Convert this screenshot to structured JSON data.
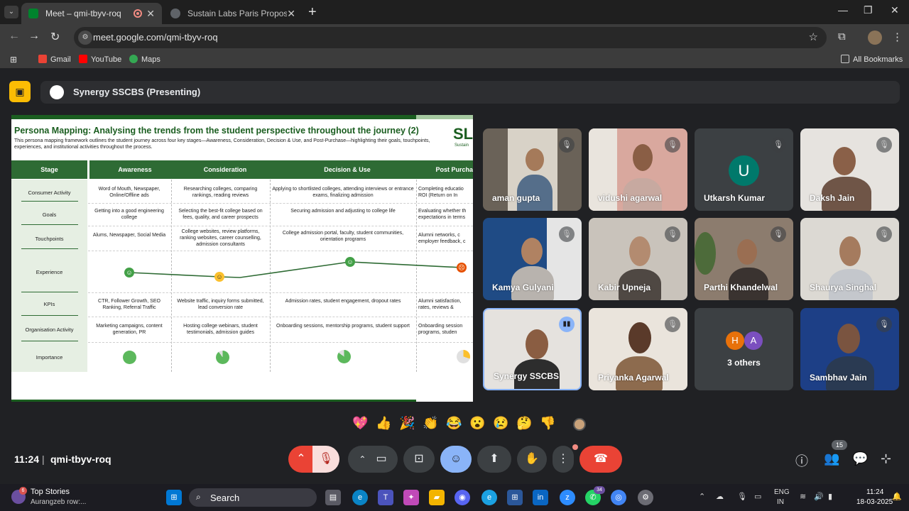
{
  "browser": {
    "tabs": [
      {
        "title": "Meet – qmi-tbyv-roq",
        "active": true
      },
      {
        "title": "Sustain Labs Paris Proposal - Sy",
        "active": false
      }
    ],
    "url": "meet.google.com/qmi-tbyv-roq",
    "bookmarks": [
      "Gmail",
      "YouTube",
      "Maps"
    ],
    "all_bookmarks": "All Bookmarks"
  },
  "meet": {
    "presenting_title": "Synergy SSCBS (Presenting)",
    "time": "11:24",
    "separator": "|",
    "meeting_code": "qmi-tbyv-roq",
    "people_count": "15",
    "reactions": [
      "💖",
      "👍",
      "🎉",
      "👏",
      "😂",
      "😮",
      "😢",
      "🤔",
      "👎"
    ],
    "participants": [
      {
        "name": "aman gupta",
        "muted": true
      },
      {
        "name": "vidushi agarwal",
        "muted": true
      },
      {
        "name": "Utkarsh Kumar",
        "muted": true,
        "initial": "U"
      },
      {
        "name": "Daksh Jain",
        "muted": true
      },
      {
        "name": "Kamya Gulyani",
        "muted": true
      },
      {
        "name": "Kabir Upneja",
        "muted": true
      },
      {
        "name": "Parthi Khandelwal",
        "muted": true
      },
      {
        "name": "Shaurya Singhal",
        "muted": true
      },
      {
        "name": "Synergy SSCBS",
        "muted": false,
        "speaking": true
      },
      {
        "name": "Priyanka Agarwal",
        "muted": true
      },
      {
        "name": "3 others",
        "initials": [
          "H",
          "A"
        ]
      },
      {
        "name": "Sambhav Jain",
        "muted": true
      }
    ]
  },
  "slide": {
    "title": "Persona Mapping: Analysing the trends from the student perspective throughout the journey (2)",
    "subtitle": "This persona mapping framework outlines the student journey across four key stages—Awareness, Consideration, Decision & Use, and Post-Purchase—highlighting their goals, touchpoints, experiences, and institutional activities throughout the process.",
    "logo": "SL",
    "logo_sub": "Sustain",
    "headers": [
      "Stage",
      "Awareness",
      "Consideration",
      "Decision & Use",
      "Post Purcha"
    ],
    "row_labels": [
      "Consumer Activity",
      "Goals",
      "Touchpoints",
      "Experience",
      "KPIs",
      "Organisation Activity",
      "Importance"
    ],
    "rows": {
      "consumer_activity": [
        "Word of Mouth, Newspaper, Online/Offline ads",
        "Researching colleges, comparing rankings, reading reviews",
        "Applying to shortlisted colleges, attending interviews or entrance exams, finalizing admission",
        "Completing educatio ROI (Return on In"
      ],
      "goals": [
        "Getting into a good engineering college",
        "Selecting the best-fit college based on fees, quality, and career prospects",
        "Securing admission and adjusting to college life",
        "Evaluating whether th expectations in terms"
      ],
      "touchpoints": [
        "Alums, Newspaper, Social Media",
        "College websites, review platforms, ranking websites, career counselling, admission consultants",
        "College admission portal, faculty, student communities, orientation programs",
        "Alumni networks, c employer feedback, c"
      ],
      "kpis": [
        "CTR, Follower Growth, SEO Ranking, Referral Traffic",
        "Website traffic, inquiry forms submitted, lead conversion rate",
        "Admission rates, student engagement, dropout rates",
        "Alumni satisfaction, rates, reviews &"
      ],
      "org_activity": [
        "Marketing campaigns, content generation, PR",
        "Hosting college webinars, student testimonials, admission guides",
        "Onboarding sessions, mentorship programs, student support",
        "Onboarding session programs, studen"
      ]
    },
    "importance": [
      1.0,
      0.9,
      0.85,
      0.3
    ],
    "colors": {
      "green": "#2e6b34",
      "dark_green": "#1b5e20",
      "yellow": "#fbc02d",
      "orange": "#e65100"
    }
  },
  "taskbar": {
    "news_title": "Top Stories",
    "news_sub": "Aurangzeb row:...",
    "news_badge": "6",
    "search": "Search",
    "whatsapp_badge": "34",
    "lang": "ENG",
    "region": "IN",
    "time": "11:24",
    "date": "18-03-2025"
  }
}
